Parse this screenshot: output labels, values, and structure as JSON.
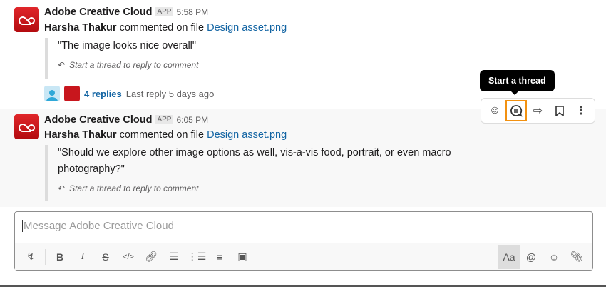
{
  "messages": [
    {
      "sender": "Adobe Creative Cloud",
      "badge": "APP",
      "time": "5:58 PM",
      "author": "Harsha Thakur",
      "action": "commented on file",
      "file": "Design asset.png",
      "quote": "\"The image looks nice overall\"",
      "hint": "Start a thread to reply to comment",
      "replies": "4 replies",
      "last_reply": "Last reply 5 days ago"
    },
    {
      "sender": "Adobe Creative Cloud",
      "badge": "APP",
      "time": "6:05 PM",
      "author": "Harsha Thakur",
      "action": "commented on file",
      "file": "Design asset.png",
      "quote": "\"Should we explore other image options as well, vis-a-vis food, portrait, or even macro photography?\"",
      "hint": "Start a thread to reply to comment"
    }
  ],
  "tooltip": "Start a thread",
  "composer": {
    "placeholder": "Message Adobe Creative Cloud",
    "format_label": "Aa"
  },
  "colors": {
    "link": "#1264a3",
    "highlight": "#f29111",
    "brand": "#da1f26"
  }
}
